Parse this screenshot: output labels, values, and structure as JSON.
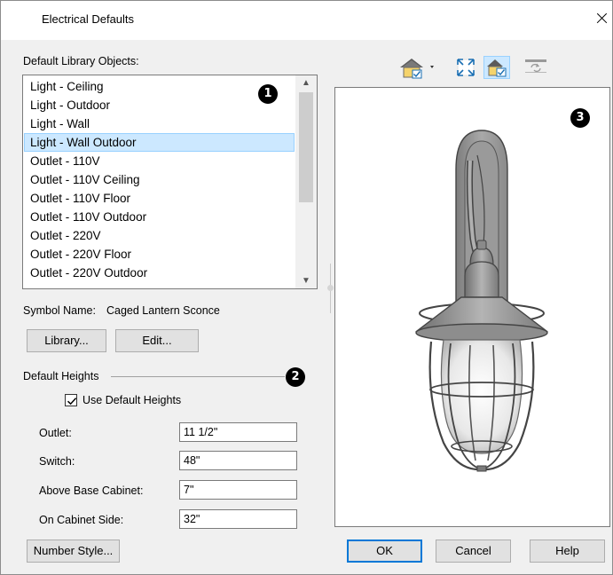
{
  "window": {
    "title": "Electrical Defaults"
  },
  "library_section": {
    "label": "Default Library Objects:"
  },
  "library_list": {
    "items": [
      "Light - Ceiling",
      "Light - Outdoor",
      "Light - Wall",
      "Light - Wall Outdoor",
      "Outlet - 110V",
      "Outlet - 110V Ceiling",
      "Outlet - 110V Floor",
      "Outlet - 110V Outdoor",
      "Outlet - 220V",
      "Outlet - 220V Floor",
      "Outlet - 220V Outdoor"
    ],
    "selected": "Light - Wall Outdoor"
  },
  "symbol": {
    "label": "Symbol Name:",
    "value": "Caged Lantern Sconce"
  },
  "buttons": {
    "library": "Library...",
    "edit": "Edit...",
    "number_style": "Number Style...",
    "ok": "OK",
    "cancel": "Cancel",
    "help": "Help"
  },
  "heights": {
    "group_label": "Default Heights",
    "use_default_label": "Use Default Heights",
    "use_default_checked": true,
    "fields": [
      {
        "label": "Outlet:",
        "value": "11 1/2\""
      },
      {
        "label": "Switch:",
        "value": "48\""
      },
      {
        "label": "Above Base Cabinet:",
        "value": "7\""
      },
      {
        "label": "On Cabinet Side:",
        "value": "32\""
      }
    ]
  },
  "callouts": [
    "1",
    "2",
    "3"
  ],
  "preview_toolbar": [
    "render-style-icon",
    "fill-window-icon",
    "show-back-clipping-icon",
    "reset-view-icon"
  ],
  "colors": {
    "selection": "#cce8ff",
    "accent": "#0078d7",
    "dialog_bg": "#f0f0f0"
  }
}
